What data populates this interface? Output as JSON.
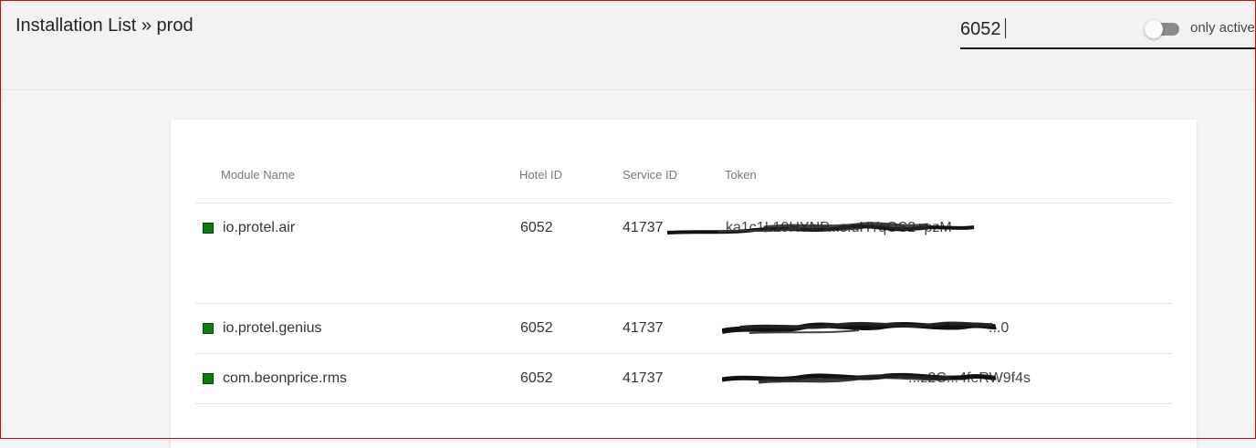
{
  "header": {
    "title": "Installation List » prod",
    "search_value": "6052",
    "toggle_label": "only active",
    "toggle_on": false
  },
  "table": {
    "columns": [
      "Module Name",
      "Hotel ID",
      "Service ID",
      "Token"
    ],
    "rows": [
      {
        "status": "active",
        "module": "io.protel.air",
        "hotel_id": "6052",
        "service_id": "41737",
        "token": "ka1c1L19HYNP...s.uHYqOS2+pzM"
      },
      {
        "status": "active",
        "module": "io.protel.genius",
        "hotel_id": "6052",
        "service_id": "41737",
        "token": "...0"
      },
      {
        "status": "active",
        "module": "com.beonprice.rms",
        "hotel_id": "6052",
        "service_id": "41737",
        "token": "...z2C...4feRW9f4s"
      }
    ]
  },
  "colors": {
    "active_status": "#0a7d0a",
    "header_bg": "#f2f2f2",
    "card_bg": "#ffffff",
    "frame": "#e00000"
  },
  "icons": {
    "status": "green-square-icon",
    "toggle": "toggle-switch"
  }
}
